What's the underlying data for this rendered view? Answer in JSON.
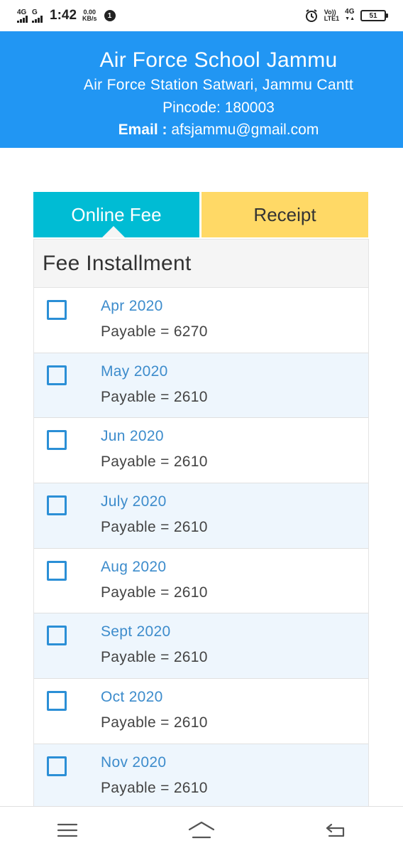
{
  "status_bar": {
    "signal1_label": "4G",
    "signal2_label": "G",
    "time": "1:42",
    "speed_value": "0.00",
    "speed_unit": "KB/s",
    "notification_count": "1",
    "volte_top": "Vo))",
    "volte_bottom": "LTE1",
    "network_label": "4G",
    "battery_level": "51"
  },
  "header": {
    "school_name": "Air Force School Jammu",
    "address": "Air Force Station Satwari, Jammu Cantt",
    "pincode": "Pincode: 180003",
    "email_label": "Email :",
    "email_value": "afsjammu@gmail.com",
    "background_color": "#2196f3"
  },
  "tabs": {
    "online_fee": "Online Fee",
    "receipt": "Receipt",
    "online_color": "#00bcd4",
    "receipt_color": "#ffd966"
  },
  "panel": {
    "title": "Fee Installment",
    "installments": [
      {
        "month": "Apr 2020",
        "payable": "Payable = 6270",
        "checked": false
      },
      {
        "month": "May 2020",
        "payable": "Payable = 2610",
        "checked": false
      },
      {
        "month": "Jun 2020",
        "payable": "Payable = 2610",
        "checked": false
      },
      {
        "month": "July 2020",
        "payable": "Payable = 2610",
        "checked": false
      },
      {
        "month": "Aug 2020",
        "payable": "Payable = 2610",
        "checked": false
      },
      {
        "month": "Sept 2020",
        "payable": "Payable = 2610",
        "checked": false
      },
      {
        "month": "Oct 2020",
        "payable": "Payable = 2610",
        "checked": false
      },
      {
        "month": "Nov 2020",
        "payable": "Payable = 2610",
        "checked": false
      }
    ]
  },
  "navbar": {
    "icons": [
      "menu-icon",
      "home-icon",
      "back-icon"
    ]
  }
}
